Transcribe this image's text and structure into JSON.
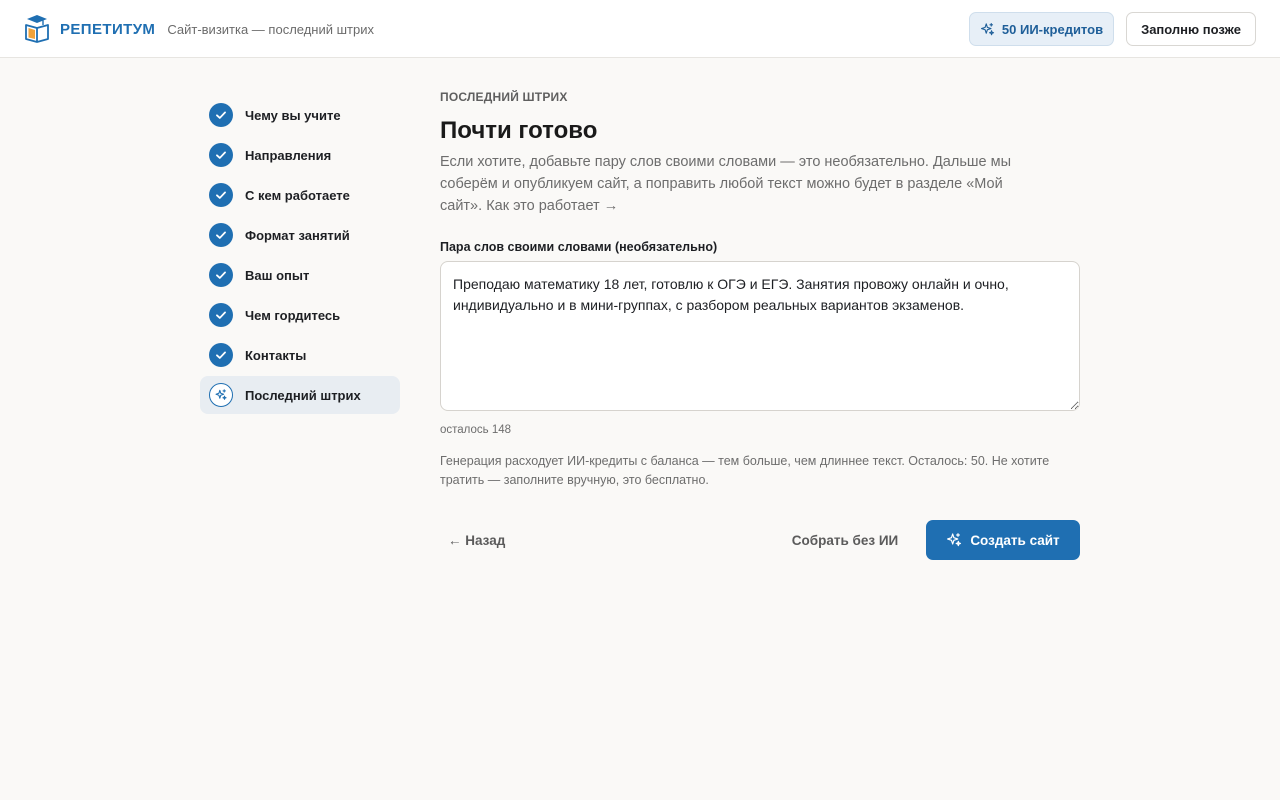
{
  "header": {
    "brand_name": "РЕПЕТИТУМ",
    "subtitle": "Сайт-визитка — последний штрих",
    "credits_label": "50 ИИ-кредитов",
    "later_label": "Заполню позже"
  },
  "sidebar": {
    "steps": [
      {
        "label": "Чему вы учите",
        "state": "done"
      },
      {
        "label": "Направления",
        "state": "done"
      },
      {
        "label": "С кем работаете",
        "state": "done"
      },
      {
        "label": "Формат занятий",
        "state": "done"
      },
      {
        "label": "Ваш опыт",
        "state": "done"
      },
      {
        "label": "Чем гордитесь",
        "state": "done"
      },
      {
        "label": "Контакты",
        "state": "done"
      },
      {
        "label": "Последний штрих",
        "state": "active"
      }
    ]
  },
  "main": {
    "eyebrow": "ПОСЛЕДНИЙ ШТРИХ",
    "title": "Почти готово",
    "lead": "Если хотите, добавьте пару слов своими словами — это необязательно. Дальше мы соберём и опубликуем сайт, а поправить любой текст можно будет в разделе «Мой сайт».",
    "how_link": "Как это работает →",
    "field_label": "Пара слов своими словами (необязательно)",
    "field_value": "Преподаю математику 18 лет, готовлю к ОГЭ и ЕГЭ. Занятия провожу онлайн и очно, индивидуально и в мини-группах, с разбором реальных вариантов экзаменов.",
    "counter": "осталось 148",
    "note": "Генерация расходует ИИ-кредиты с баланса — тем больше, чем длиннее текст. Осталось: 50. Не хотите тратить — заполните вручную, это бесплатно."
  },
  "actions": {
    "back_label": "← Назад",
    "no_ai_label": "Собрать без ИИ",
    "create_label": "Создать сайт"
  },
  "colors": {
    "accent": "#1f6fb2",
    "background": "#faf9f7",
    "muted_text": "#6d6d6d"
  },
  "icons": {
    "brand": "book-cap-logo-icon",
    "credits": "sparkles-icon",
    "step_done": "check-icon",
    "step_active": "sparkles-icon",
    "create": "sparkles-icon"
  }
}
